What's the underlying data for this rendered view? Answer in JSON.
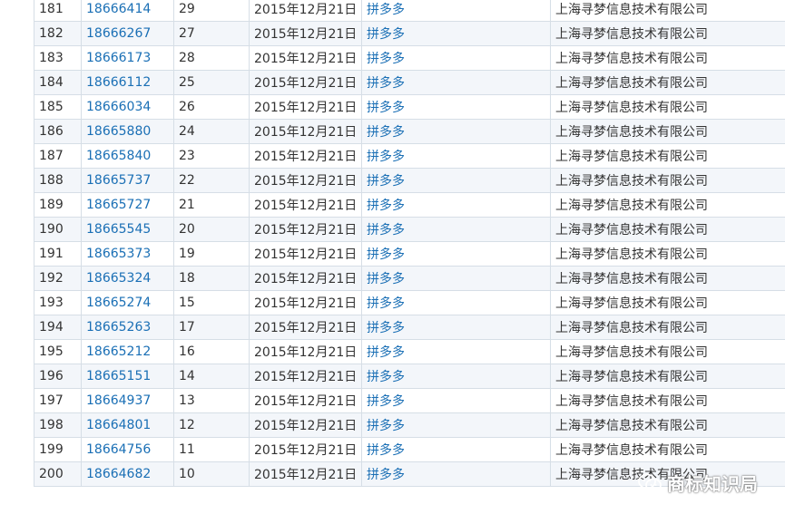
{
  "table": {
    "rows": [
      {
        "index": "181",
        "reg_no": "18666414",
        "class": "29",
        "date": "2015年12月21日",
        "mark": "拼多多",
        "applicant": "上海寻梦信息技术有限公司"
      },
      {
        "index": "182",
        "reg_no": "18666267",
        "class": "27",
        "date": "2015年12月21日",
        "mark": "拼多多",
        "applicant": "上海寻梦信息技术有限公司"
      },
      {
        "index": "183",
        "reg_no": "18666173",
        "class": "28",
        "date": "2015年12月21日",
        "mark": "拼多多",
        "applicant": "上海寻梦信息技术有限公司"
      },
      {
        "index": "184",
        "reg_no": "18666112",
        "class": "25",
        "date": "2015年12月21日",
        "mark": "拼多多",
        "applicant": "上海寻梦信息技术有限公司"
      },
      {
        "index": "185",
        "reg_no": "18666034",
        "class": "26",
        "date": "2015年12月21日",
        "mark": "拼多多",
        "applicant": "上海寻梦信息技术有限公司"
      },
      {
        "index": "186",
        "reg_no": "18665880",
        "class": "24",
        "date": "2015年12月21日",
        "mark": "拼多多",
        "applicant": "上海寻梦信息技术有限公司"
      },
      {
        "index": "187",
        "reg_no": "18665840",
        "class": "23",
        "date": "2015年12月21日",
        "mark": "拼多多",
        "applicant": "上海寻梦信息技术有限公司"
      },
      {
        "index": "188",
        "reg_no": "18665737",
        "class": "22",
        "date": "2015年12月21日",
        "mark": "拼多多",
        "applicant": "上海寻梦信息技术有限公司"
      },
      {
        "index": "189",
        "reg_no": "18665727",
        "class": "21",
        "date": "2015年12月21日",
        "mark": "拼多多",
        "applicant": "上海寻梦信息技术有限公司"
      },
      {
        "index": "190",
        "reg_no": "18665545",
        "class": "20",
        "date": "2015年12月21日",
        "mark": "拼多多",
        "applicant": "上海寻梦信息技术有限公司"
      },
      {
        "index": "191",
        "reg_no": "18665373",
        "class": "19",
        "date": "2015年12月21日",
        "mark": "拼多多",
        "applicant": "上海寻梦信息技术有限公司"
      },
      {
        "index": "192",
        "reg_no": "18665324",
        "class": "18",
        "date": "2015年12月21日",
        "mark": "拼多多",
        "applicant": "上海寻梦信息技术有限公司"
      },
      {
        "index": "193",
        "reg_no": "18665274",
        "class": "15",
        "date": "2015年12月21日",
        "mark": "拼多多",
        "applicant": "上海寻梦信息技术有限公司"
      },
      {
        "index": "194",
        "reg_no": "18665263",
        "class": "17",
        "date": "2015年12月21日",
        "mark": "拼多多",
        "applicant": "上海寻梦信息技术有限公司"
      },
      {
        "index": "195",
        "reg_no": "18665212",
        "class": "16",
        "date": "2015年12月21日",
        "mark": "拼多多",
        "applicant": "上海寻梦信息技术有限公司"
      },
      {
        "index": "196",
        "reg_no": "18665151",
        "class": "14",
        "date": "2015年12月21日",
        "mark": "拼多多",
        "applicant": "上海寻梦信息技术有限公司"
      },
      {
        "index": "197",
        "reg_no": "18664937",
        "class": "13",
        "date": "2015年12月21日",
        "mark": "拼多多",
        "applicant": "上海寻梦信息技术有限公司"
      },
      {
        "index": "198",
        "reg_no": "18664801",
        "class": "12",
        "date": "2015年12月21日",
        "mark": "拼多多",
        "applicant": "上海寻梦信息技术有限公司"
      },
      {
        "index": "199",
        "reg_no": "18664756",
        "class": "11",
        "date": "2015年12月21日",
        "mark": "拼多多",
        "applicant": "上海寻梦信息技术有限公司"
      },
      {
        "index": "200",
        "reg_no": "18664682",
        "class": "10",
        "date": "2015年12月21日",
        "mark": "拼多多",
        "applicant": "上海寻梦信息技术有限公司"
      }
    ]
  },
  "watermark": {
    "text": "商标知识局",
    "icon": "wechat-icon"
  },
  "colors": {
    "link": "#1a6fb5",
    "text": "#333333",
    "row_alt": "#f3f6fa",
    "border": "#d6dee6"
  }
}
